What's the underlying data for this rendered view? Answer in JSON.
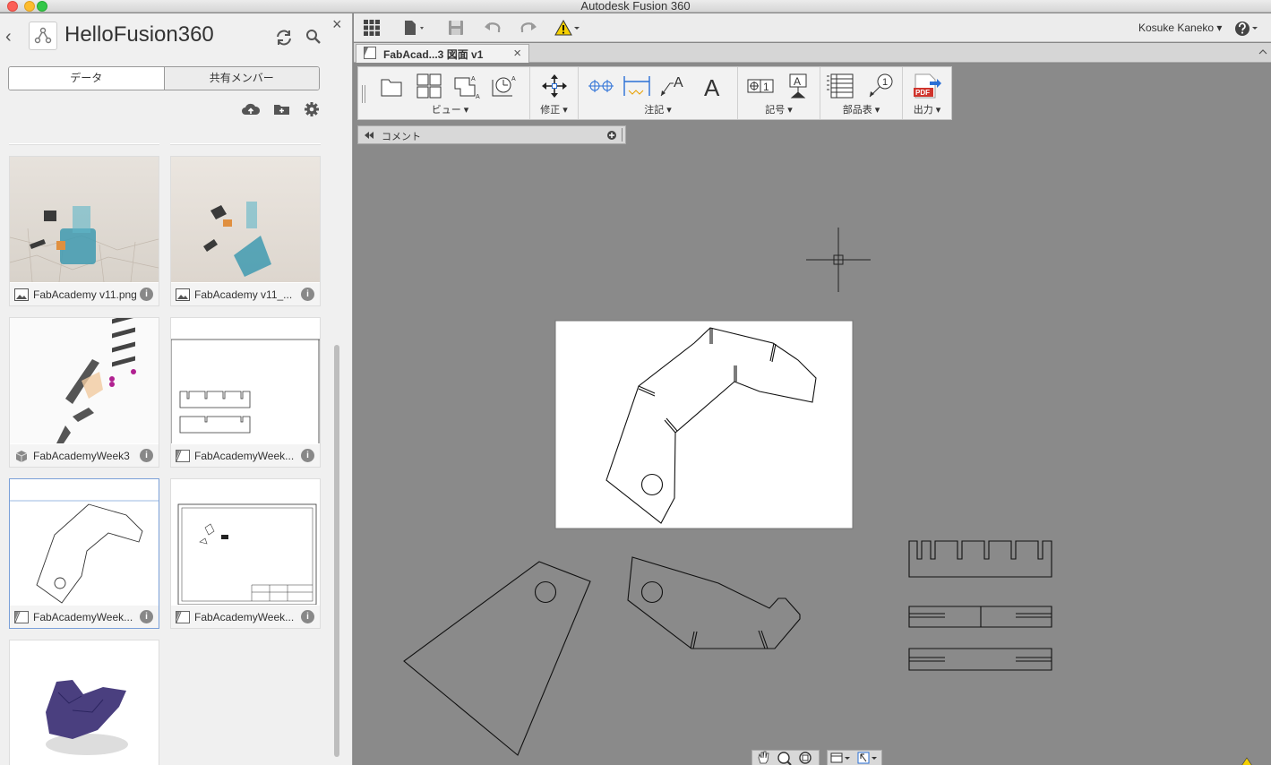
{
  "window": {
    "title": "Autodesk Fusion 360"
  },
  "panel": {
    "project_title": "HelloFusion360",
    "tabs": [
      "データ",
      "共有メンバー"
    ],
    "files": [
      {
        "name": "FabAcademy v11.png",
        "type": "image"
      },
      {
        "name": "FabAcademy v11_...",
        "type": "image"
      },
      {
        "name": "FabAcademyWeek3",
        "type": "design"
      },
      {
        "name": "FabAcademyWeek...",
        "type": "drawing"
      },
      {
        "name": "FabAcademyWeek...",
        "type": "drawing"
      },
      {
        "name": "FabAcademyWeek...",
        "type": "drawing"
      },
      {
        "name": "",
        "type": "design"
      }
    ],
    "info_glyph": "i"
  },
  "toolbar": {
    "user": "Kosuke Kaneko ▾"
  },
  "tab": {
    "label": "FabAcad...3 図面 v1"
  },
  "ribbon": {
    "groups": [
      "ビュー ▾",
      "修正 ▾",
      "注記 ▾",
      "記号 ▾",
      "部品表 ▾",
      "出力 ▾"
    ]
  },
  "comment_bar": {
    "label": "コメント"
  },
  "colors": {
    "canvas": "#8a8a8a",
    "panel": "#f0f0f0",
    "accent": "#2a6fd6"
  }
}
